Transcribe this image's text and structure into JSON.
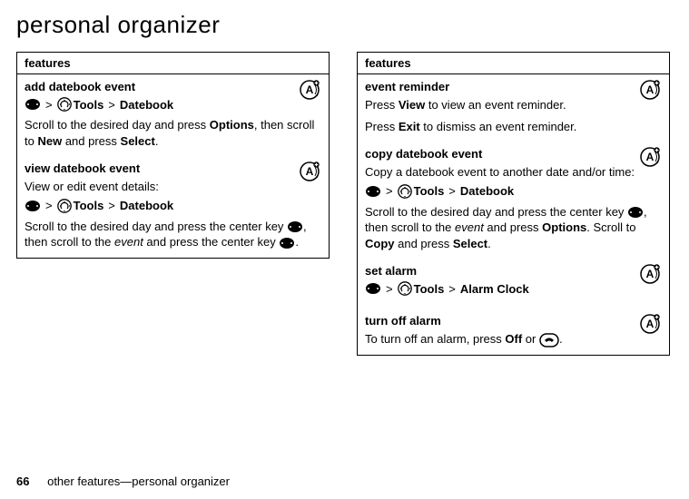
{
  "page_title": "personal organizer",
  "footer": {
    "page_number": "66",
    "text": "other features—personal organizer"
  },
  "left_header": "features",
  "right_header": "features",
  "labels": {
    "tools": "Tools",
    "datebook": "Datebook",
    "alarm_clock": "Alarm Clock",
    "options": "Options",
    "new": "New",
    "select": "Select",
    "view": "View",
    "exit": "Exit",
    "copy": "Copy",
    "off": "Off"
  },
  "left_rows": [
    {
      "title": "add datebook event",
      "desc_pre": "Scroll to the desired day and press ",
      "desc_mid": ", then scroll to ",
      "desc_post": " and press "
    },
    {
      "title": "view datebook event",
      "lead": "View or edit event details:",
      "desc_pre": "Scroll to the desired day and press the center key ",
      "desc_mid": ", then scroll to the ",
      "event_word": "event",
      "desc_mid2": " and press the center key ",
      "desc_post": "."
    }
  ],
  "right_rows": [
    {
      "title": "event reminder",
      "line1_pre": "Press ",
      "line1_post": " to view an event reminder.",
      "line2_pre": "Press ",
      "line2_post": " to dismiss an event reminder."
    },
    {
      "title": "copy datebook event",
      "lead": "Copy a datebook event to another date and/or time:",
      "desc_pre": "Scroll to the desired day and press the center key ",
      "desc_mid": ", then scroll to the ",
      "event_word": "event",
      "desc_mid2": " and press ",
      "desc_mid3": ". Scroll to ",
      "desc_post": " and press "
    },
    {
      "title": "set alarm"
    },
    {
      "title": "turn off alarm",
      "desc_pre": "To turn off an alarm, press ",
      "desc_mid": " or ",
      "desc_post": "."
    }
  ]
}
